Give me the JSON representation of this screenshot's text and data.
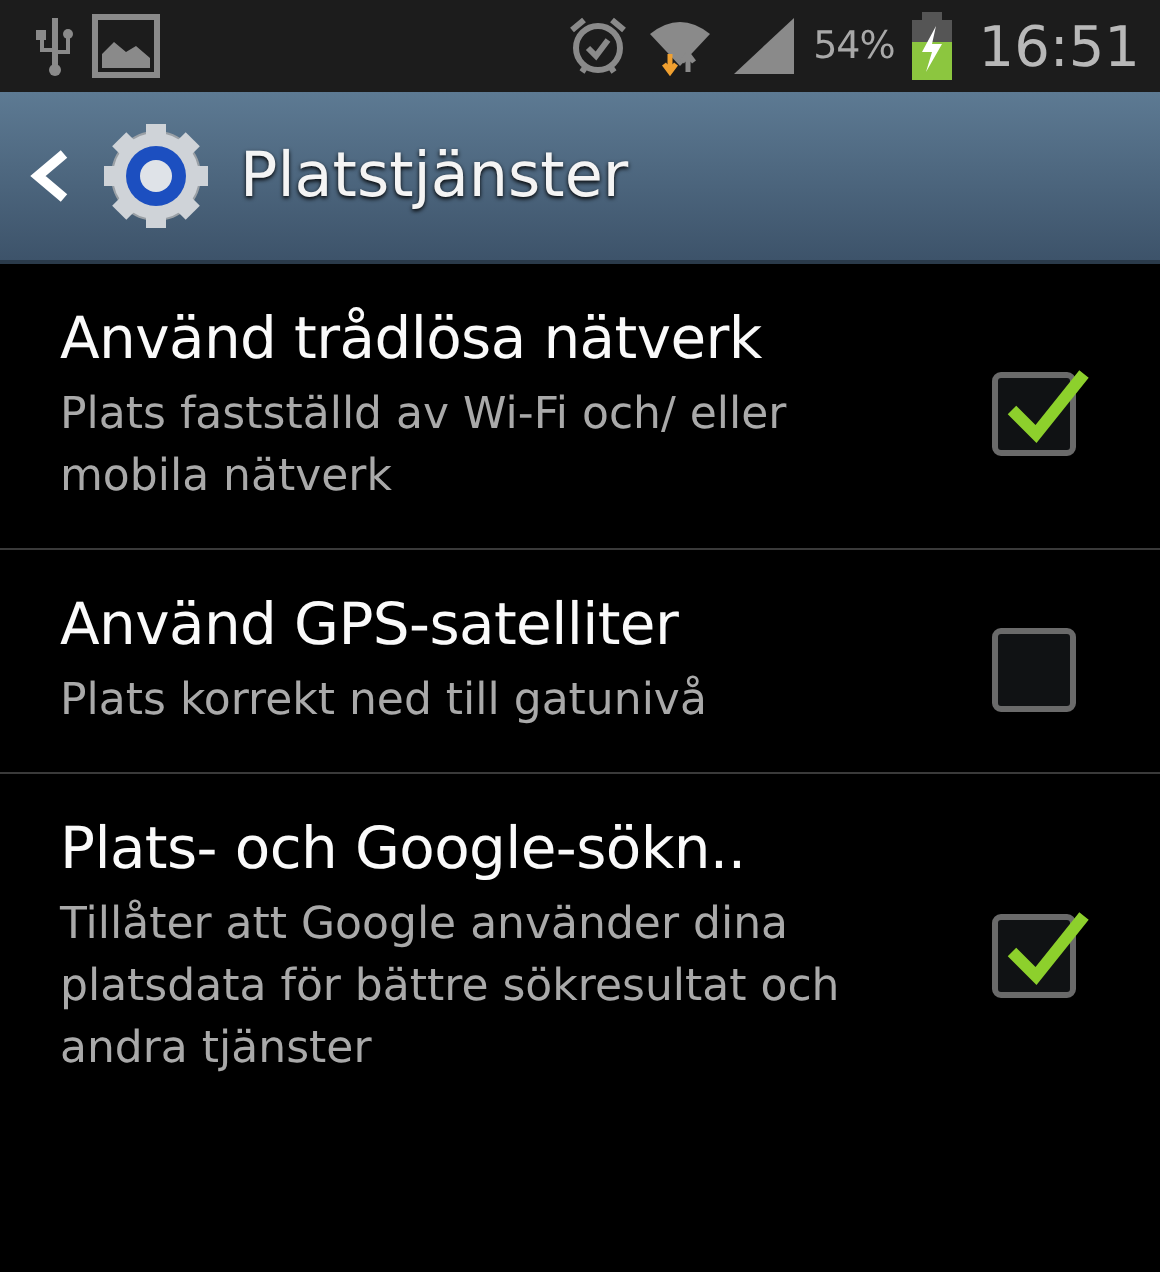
{
  "status_bar": {
    "battery_percent": "54%",
    "time": "16:51"
  },
  "action_bar": {
    "title": "Platstjänster"
  },
  "settings": [
    {
      "title": "Använd trådlösa nätverk",
      "summary": "Plats fastställd av Wi-Fi och/ eller mobila nätverk",
      "checked": true
    },
    {
      "title": "Använd GPS-satelliter",
      "summary": "Plats korrekt ned till gatunivå",
      "checked": false
    },
    {
      "title": "Plats- och Google-sökn..",
      "summary": "Tillåter att Google använder dina platsdata för bättre sökresultat och andra tjänster",
      "checked": true
    }
  ]
}
